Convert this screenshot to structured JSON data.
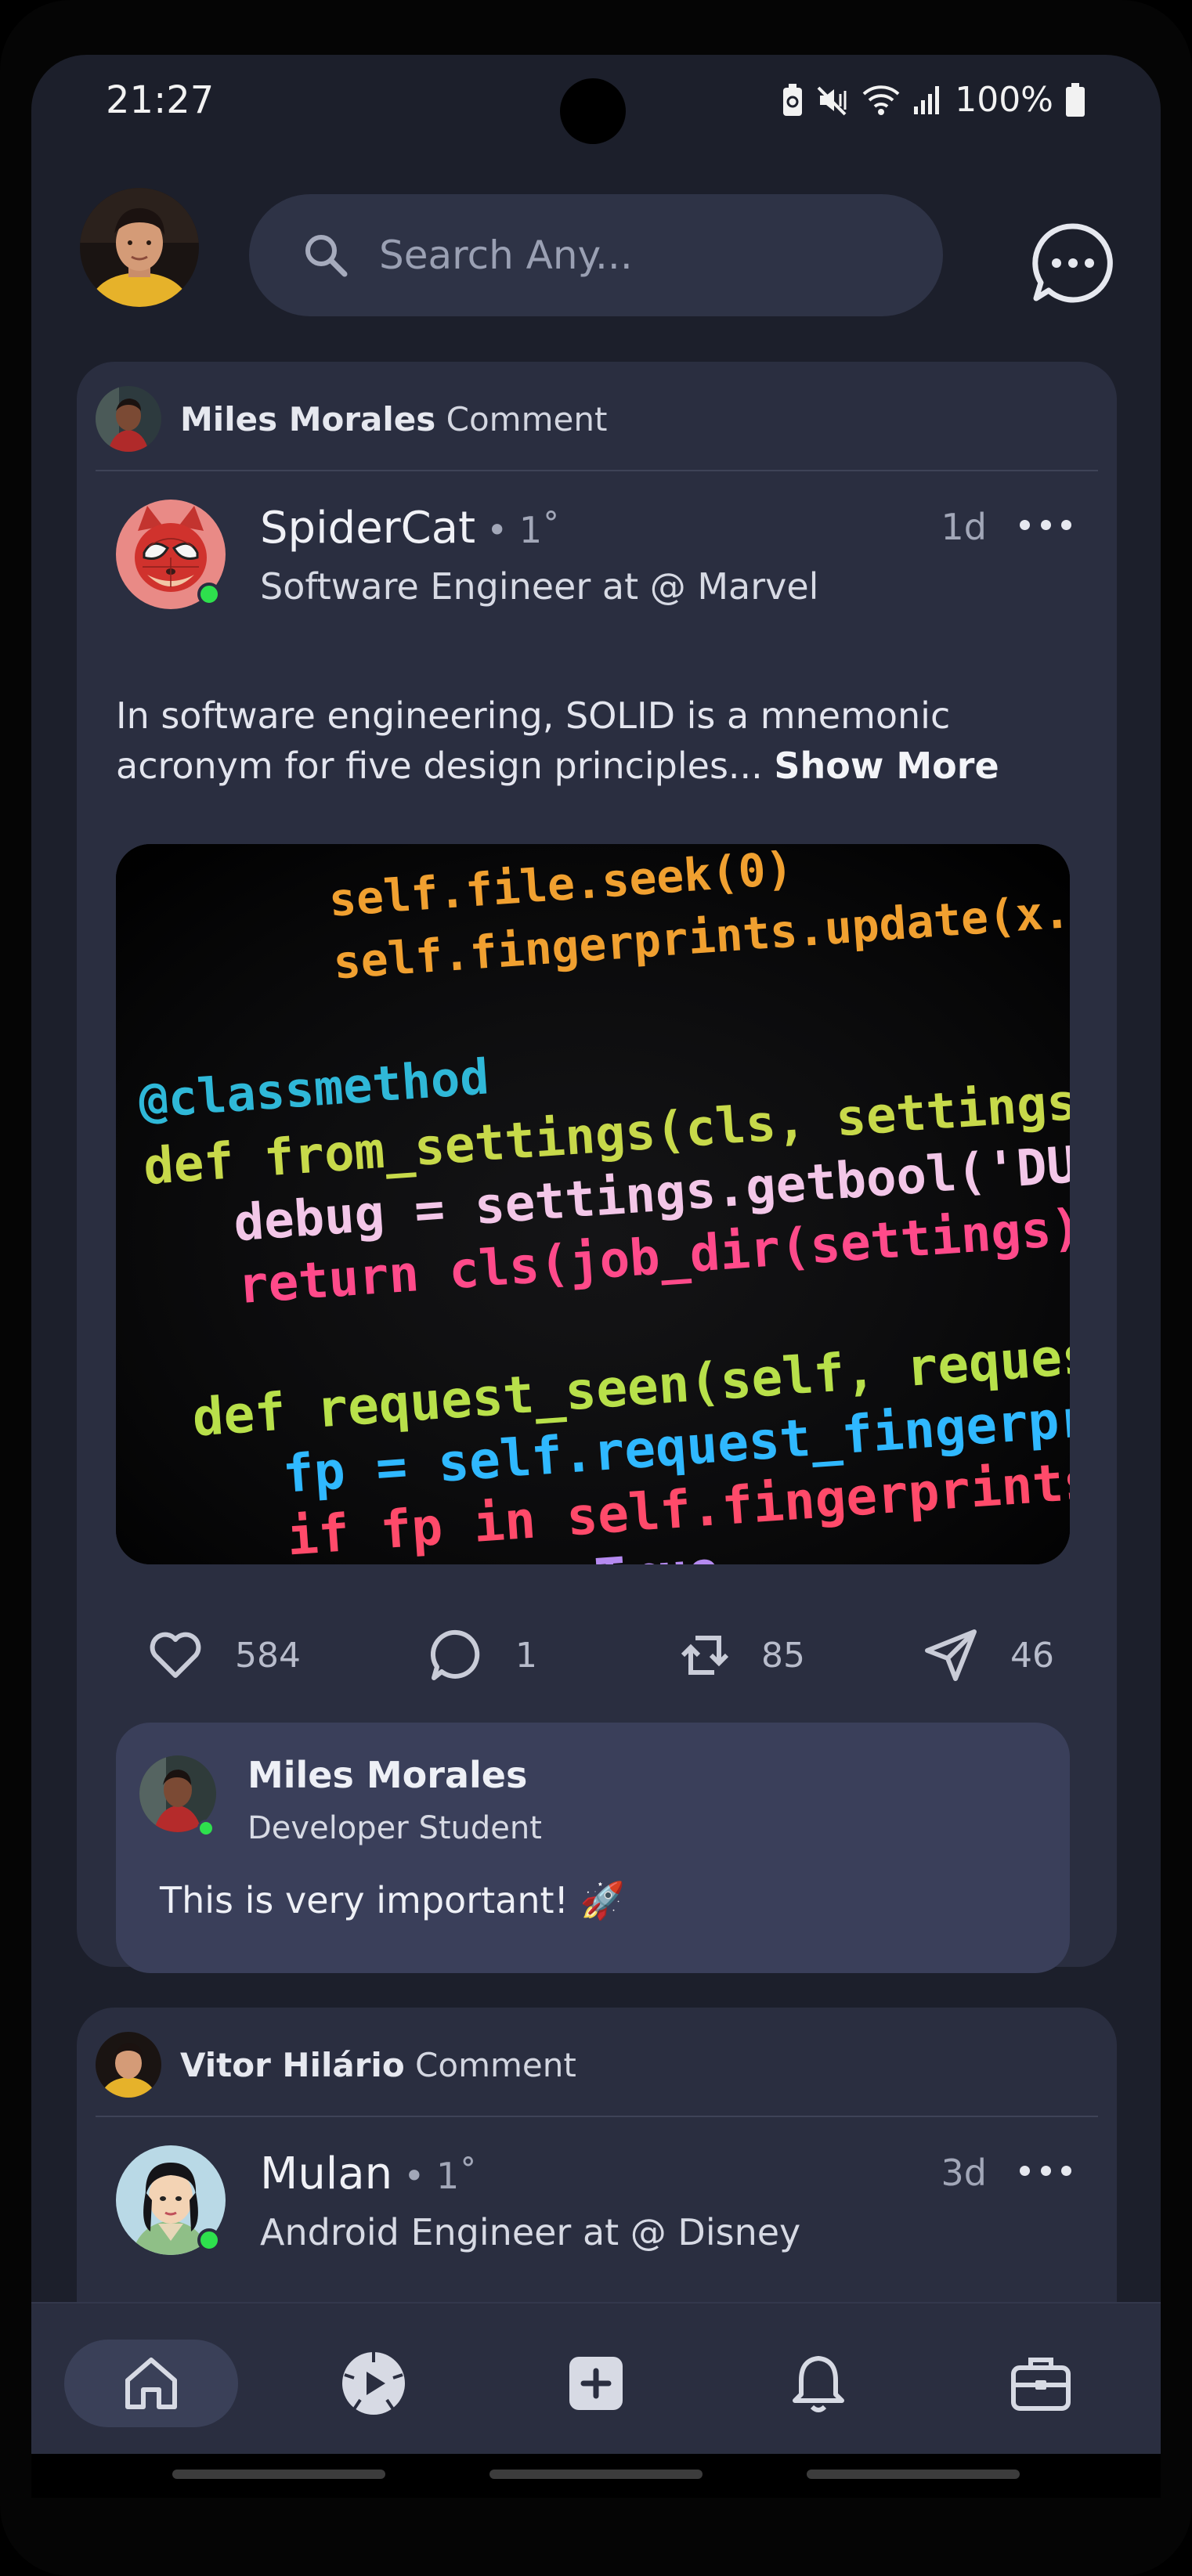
{
  "status_bar": {
    "time": "21:27",
    "battery": "100%"
  },
  "header": {
    "search_placeholder": "Search Any..."
  },
  "feed": [
    {
      "activity_user": "Miles Morales",
      "activity_action": "Comment",
      "author_name": "SpiderCat",
      "connection": "• 1˚",
      "author_title": "Software Engineer at @ Marvel",
      "time": "1d",
      "text": "In software engineering, SOLID is a mnemonic acronym for five design principles...",
      "show_more": "Show More",
      "likes": "584",
      "comments": "1",
      "reposts": "85",
      "shares": "46",
      "comment": {
        "name": "Miles Morales",
        "role": "Developer Student",
        "text": "This is very important! 🚀"
      }
    },
    {
      "activity_user": "Vitor Hilário",
      "activity_action": "Comment",
      "author_name": "Mulan",
      "connection": "• 1˚",
      "author_title": "Android Engineer at @ Disney",
      "time": "3d"
    }
  ],
  "code_lines": [
    "self.file.seek(0)",
    "self.fingerprints.update(x.s)",
    "@classmethod",
    "def from_settings(cls, settings):",
    "debug = settings.getbool('DUPE",
    "return cls(job_dir(settings),",
    "def request_seen(self, request):",
    "fp = self.request_fingerprint",
    "if fp in self.fingerprints:",
    "return True"
  ],
  "nav": [
    "home",
    "explore",
    "post",
    "notifications",
    "jobs"
  ],
  "colors": {
    "background": "#1c1f2b",
    "card": "#2a2e40",
    "online": "#2ee04d",
    "comment_bg": "#3a3f5a"
  }
}
